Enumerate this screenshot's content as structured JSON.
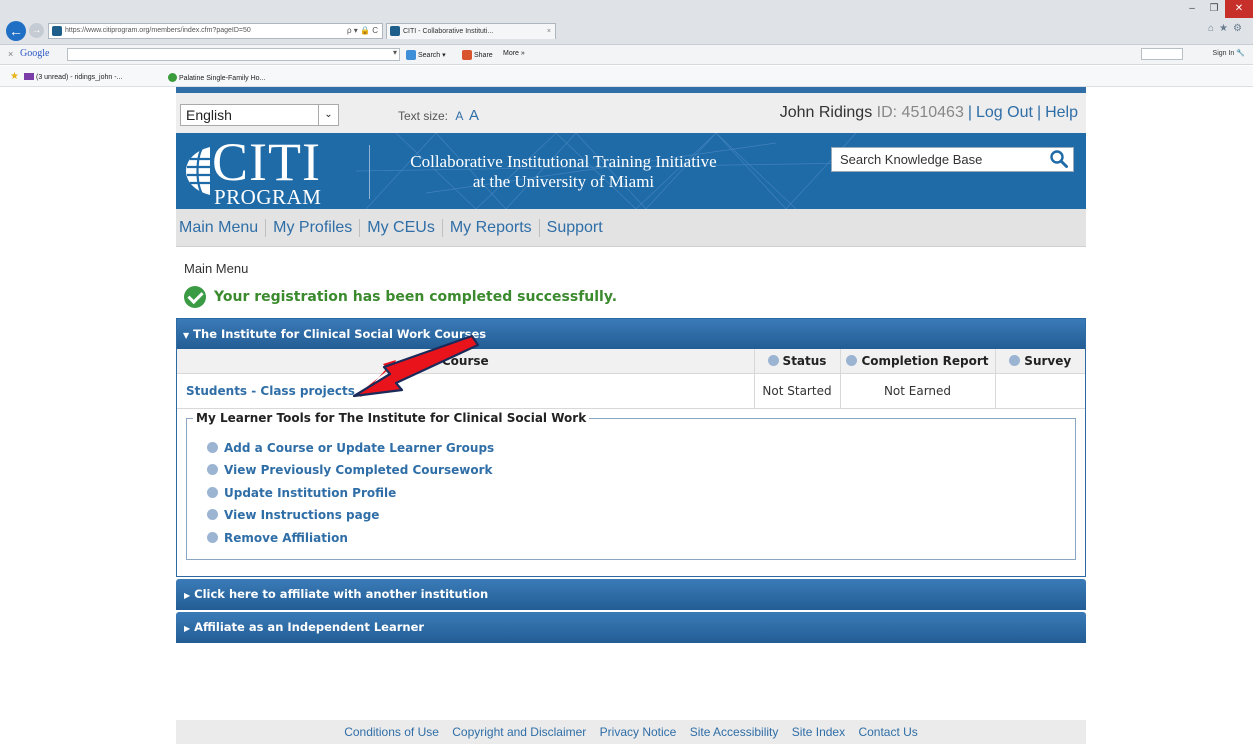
{
  "browser": {
    "address_url": "https://www.citiprogram.org/members/index.cfm?pageID=50",
    "address_host": "citiprogram.org",
    "address_tools": "ρ ▾ 🔒 C",
    "tab_title": "CITI - Collaborative Instituti...",
    "tab_close": "×",
    "toolbar": {
      "close": "×",
      "google": "Google",
      "search_label": "Search",
      "share_label": "Share",
      "more_label": "More »",
      "sign_in": "Sign In"
    },
    "favorites": {
      "mail": "(3 unread) - ridings_john -...",
      "palatine": "Palatine Single-Family Ho..."
    }
  },
  "utility": {
    "language": "English",
    "text_size_label": "Text size:",
    "text_size_small": "A",
    "text_size_large": "A",
    "user_name": "John Ridings",
    "user_id": "ID: 4510463",
    "logout": "Log Out",
    "help": "Help"
  },
  "banner": {
    "logo_main": "CITI",
    "logo_sub": "PROGRAM",
    "title_line1": "Collaborative Institutional Training Initiative",
    "title_line2": "at the University of Miami",
    "search_placeholder": "Search Knowledge Base"
  },
  "nav": [
    "Main Menu",
    "My Profiles",
    "My CEUs",
    "My Reports",
    "Support"
  ],
  "breadcrumb": "Main Menu",
  "success_message": "Your registration has been completed successfully.",
  "institution_panel": {
    "title": "The Institute for Clinical Social Work Courses",
    "columns": {
      "course": "Course",
      "status": "Status",
      "report": "Completion Report",
      "survey": "Survey"
    },
    "rows": [
      {
        "course": "Students - Class projects",
        "status": "Not Started",
        "report": "Not Earned",
        "survey": ""
      }
    ],
    "tools_legend": "My Learner Tools for The Institute for Clinical Social Work",
    "tools": [
      "Add a Course or Update Learner Groups",
      "View Previously Completed Coursework",
      "Update Institution Profile",
      "View Instructions page",
      "Remove Affiliation"
    ]
  },
  "accordions": [
    "Click here to affiliate with another institution",
    "Affiliate as an Independent Learner"
  ],
  "footer": [
    "Conditions of Use",
    "Copyright and Disclaimer",
    "Privacy Notice",
    "Site Accessibility",
    "Site Index",
    "Contact Us"
  ],
  "colors": {
    "brand_blue": "#1f6ba8",
    "link_blue": "#2f6ea7",
    "success_green": "#3b8a2e",
    "annotation_red": "#e8131b"
  }
}
